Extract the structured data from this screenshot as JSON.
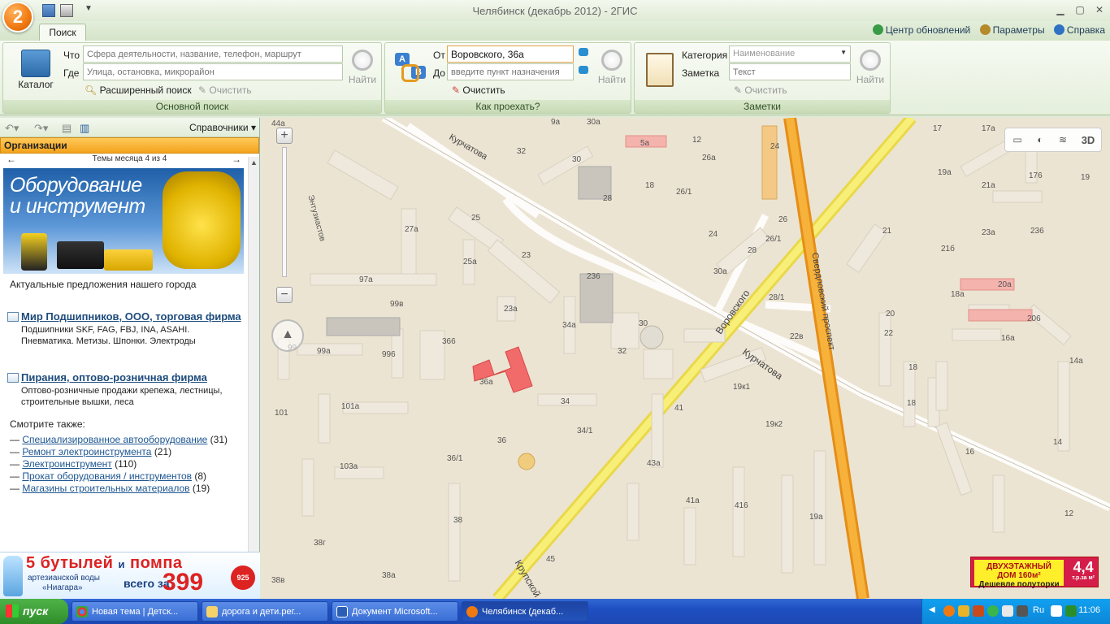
{
  "window": {
    "title": "Челябинск (декабрь 2012) - 2ГИС",
    "logo_text": "2"
  },
  "tabs": {
    "search": "Поиск"
  },
  "toplinks": {
    "updates": "Центр обновлений",
    "params": "Параметры",
    "help": "Справка"
  },
  "search_group": {
    "catalog": "Каталог",
    "what_label": "Что",
    "what_placeholder": "Сфера деятельности, название, телефон, маршрут",
    "where_label": "Где",
    "where_placeholder": "Улица, остановка, микрорайон",
    "find": "Найти",
    "advanced": "Расширенный поиск",
    "clear": "Очистить",
    "group_label": "Основной поиск"
  },
  "route_group": {
    "from_label": "От",
    "from_value": "Воровского, 36а",
    "to_label": "До",
    "to_placeholder": "введите пункт назначения",
    "find": "Найти",
    "clear": "Очистить",
    "group_label": "Как проехать?"
  },
  "notes_group": {
    "category_label": "Категория",
    "category_placeholder": "Наименование",
    "note_label": "Заметка",
    "note_placeholder": "Текст",
    "find": "Найти",
    "clear": "Очистить",
    "group_label": "Заметки"
  },
  "left_panel": {
    "reference": "Справочники",
    "org_header": "Организации",
    "themes": "Темы месяца 4 из 4",
    "banner_line1": "Оборудование",
    "banner_line2": "и инструмент",
    "offers": "Актуальные предложения нашего города",
    "firms": [
      {
        "title": "Мир Подшипников, ООО, торговая фирма",
        "desc": "Подшипники SKF, FAG, FBJ, INA, ASAHI. Пневматика. Метизы. Шпонки. Электроды"
      },
      {
        "title": "Пирания, оптово-розничная фирма",
        "desc": "Оптово-розничные продажи крепежа, лестницы, строительные вышки, леса"
      }
    ],
    "see_also_label": "Смотрите также:",
    "see_also": [
      {
        "text": "Специализированное автооборудование",
        "count": "(31)"
      },
      {
        "text": "Ремонт электроинструмента",
        "count": "(21)"
      },
      {
        "text": "Электроинструмент",
        "count": "(110)"
      },
      {
        "text": "Прокат оборудования / инструментов",
        "count": "(8)"
      },
      {
        "text": "Магазины строительных материалов",
        "count": "(19)"
      }
    ]
  },
  "bottom_ad": {
    "headline_a": "5 бутылей",
    "headline_b": "и",
    "headline_c": "помпа",
    "sub_line1": "артезианской воды",
    "sub_line2": "«Ниагара»",
    "price_label": "всего за",
    "price": "399",
    "badge": "925"
  },
  "map": {
    "tools_3d": "3D",
    "streets": {
      "kurchatova1": "Курчатова",
      "kurchatova2": "Курчатова",
      "vorovskogo": "Воровского",
      "sverdlovsky": "Свердловский проспект",
      "entuziastov": "Энтузиастов",
      "krupskoy": "Крупской"
    },
    "buildings": [
      "44а",
      "30а",
      "9а",
      "5а",
      "12",
      "32",
      "26а",
      "24",
      "17",
      "17а",
      "30",
      "18",
      "28",
      "26/1",
      "19а",
      "21а",
      "176",
      "19",
      "27а",
      "25",
      "26",
      "26/1",
      "24",
      "21",
      "23а",
      "236",
      "21б",
      "25а",
      "23",
      "28",
      "30а",
      "18а",
      "20а",
      "236",
      "97а",
      "23а",
      "28/1",
      "20",
      "22",
      "99в",
      "34а",
      "30",
      "206",
      "16а",
      "22в",
      "366",
      "996",
      "32",
      "14а",
      "99",
      "99а",
      "36а",
      "34",
      "19к1",
      "18",
      "101",
      "101а",
      "41",
      "19к2",
      "34/1",
      "16",
      "36",
      "36/1",
      "14",
      "103а",
      "43а",
      "41а",
      "416",
      "19а",
      "38",
      "12",
      "38г",
      "45",
      "38в",
      "38а",
      "18"
    ],
    "ad_left_line1": "ДВУХЭТАЖНЫЙ",
    "ad_left_line2": "ДОМ 160м²",
    "ad_left_line3": "Дешевле полуторки",
    "ad_right_value": "4,4",
    "ad_right_unit": "т.р.за м²"
  },
  "taskbar": {
    "start": "пуск",
    "tasks": [
      "Новая тема | Детск...",
      "дорога и дети.рег...",
      "Документ Microsoft...",
      "Челябинск (декаб..."
    ],
    "lang1": "RI",
    "lang2": "Ru",
    "clock": "11:06"
  }
}
